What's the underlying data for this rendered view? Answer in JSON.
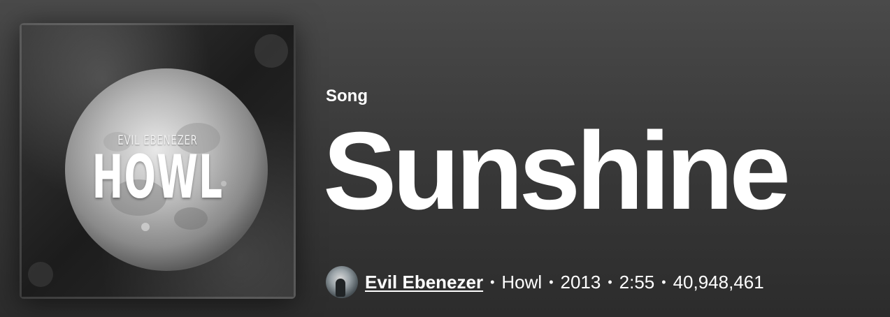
{
  "cover": {
    "artist_text": "EVIL EBENEZER",
    "title_text": "HOWL",
    "icon": "album-cover-moon"
  },
  "header": {
    "type_label": "Song",
    "title": "Sunshine"
  },
  "meta": {
    "avatar_icon": "artist-avatar",
    "artist": "Evil Ebenezer",
    "separator": "•",
    "album": "Howl",
    "year": "2013",
    "duration": "2:55",
    "play_count": "40,948,461"
  },
  "colors": {
    "background_top": "#4a4a4a",
    "background_bottom": "#2c2c2c",
    "text": "#ffffff"
  }
}
